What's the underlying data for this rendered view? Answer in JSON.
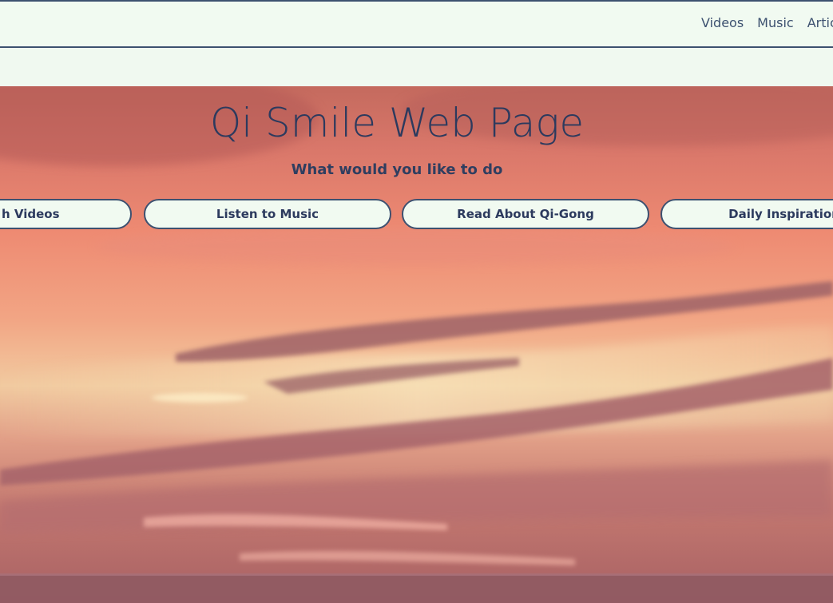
{
  "nav": {
    "links": [
      "Videos",
      "Music",
      "Artic"
    ]
  },
  "hero": {
    "title": "Qi Smile Web Page",
    "subtitle": "What would you like to do",
    "buttons": {
      "videos": "h Videos",
      "music": "Listen to Music",
      "read": "Read About Qi-Gong",
      "daily": "Daily Inspiration"
    }
  },
  "colors": {
    "nav_bg": "#f1faf1",
    "border": "#3d5170",
    "text": "#2c3a5e"
  }
}
